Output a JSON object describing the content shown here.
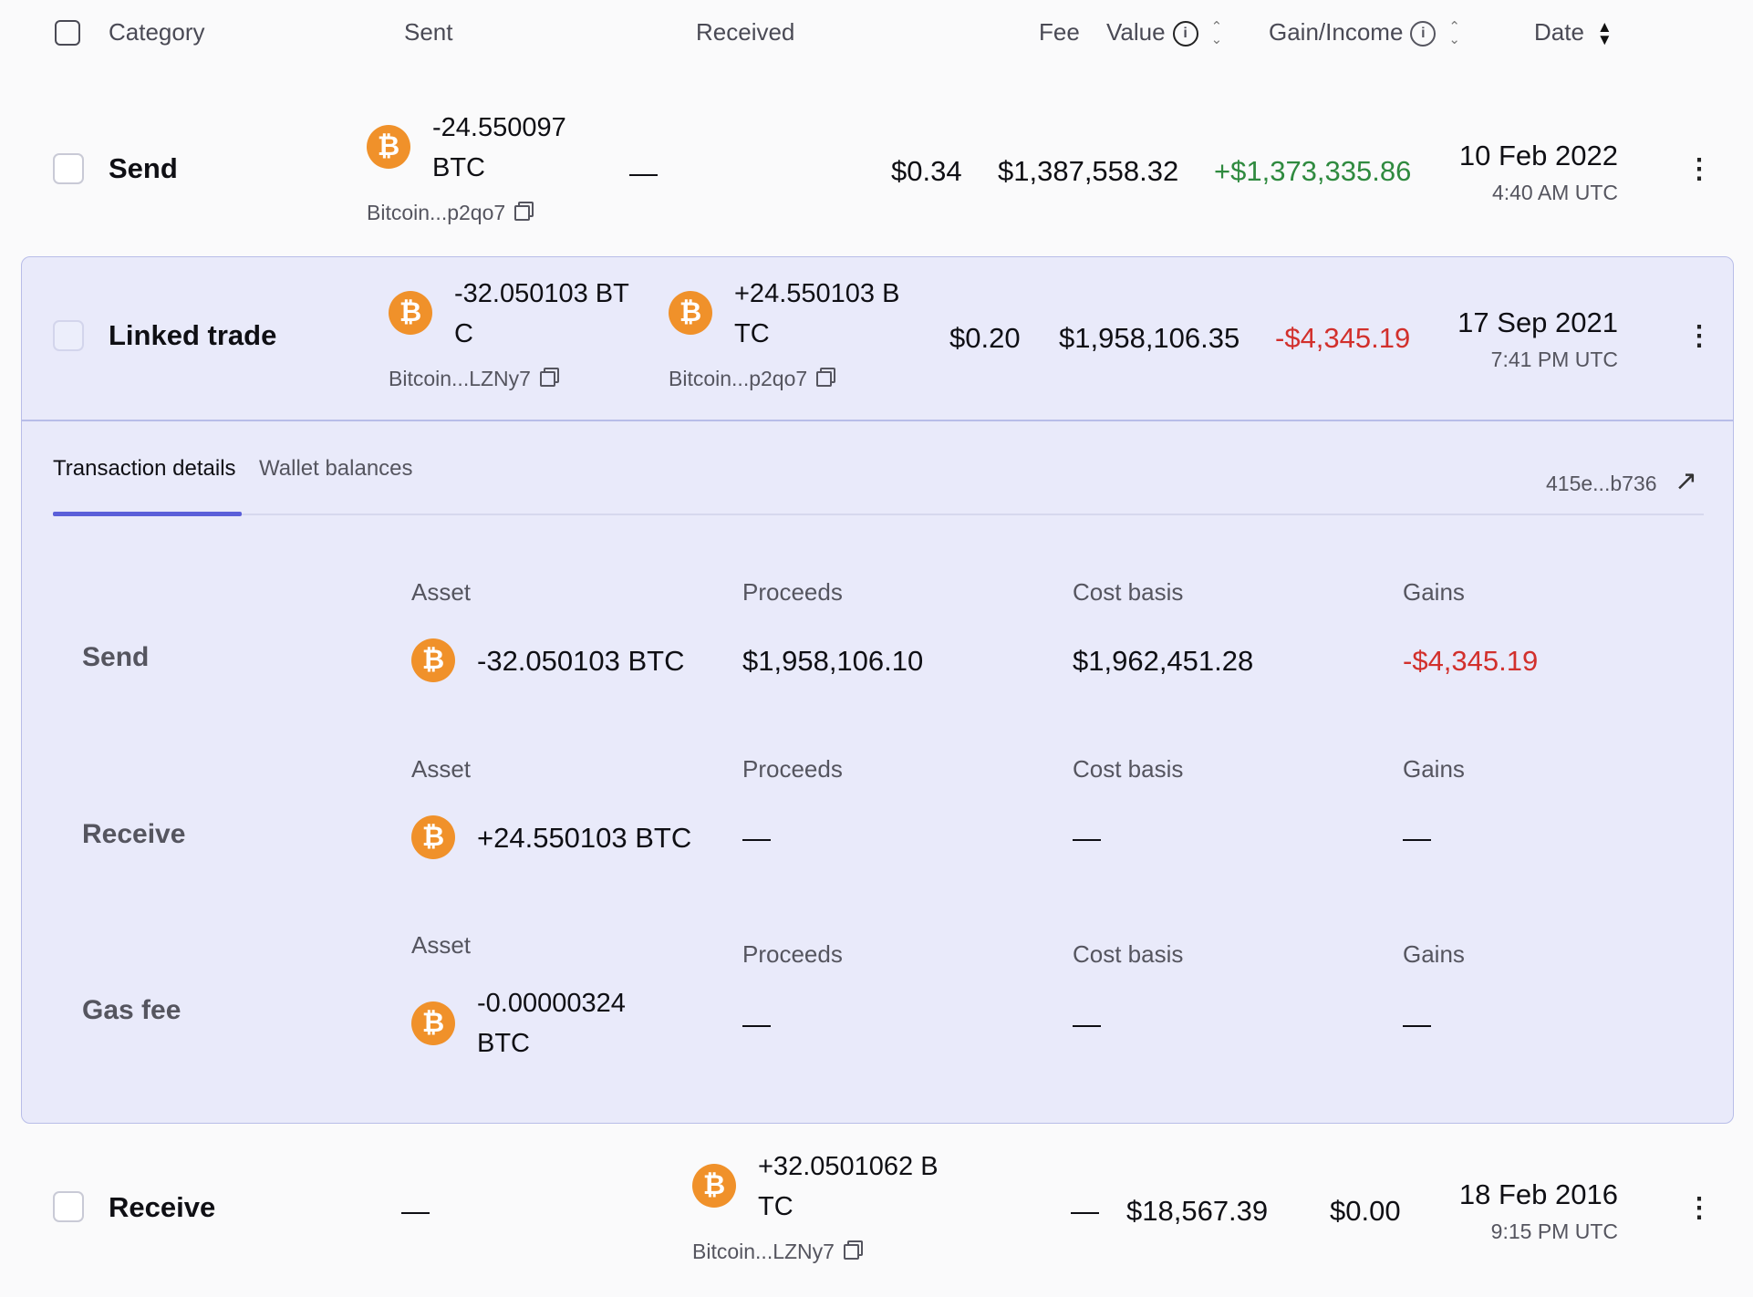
{
  "header": {
    "category": "Category",
    "sent": "Sent",
    "received": "Received",
    "fee": "Fee",
    "value": "Value",
    "gain_income": "Gain/Income",
    "date": "Date"
  },
  "rows": [
    {
      "category": "Send",
      "sent_amount_line1": "-24.550097",
      "sent_amount_line2": "BTC",
      "sent_wallet": "Bitcoin...p2qo7",
      "received": "—",
      "fee": "$0.34",
      "value": "$1,387,558.32",
      "gain": "+$1,373,335.86",
      "date": "10 Feb 2022",
      "time": "4:40 AM UTC"
    },
    {
      "category": "Linked trade",
      "sent_amount_line1": "-32.050103 BT",
      "sent_amount_line2": "C",
      "sent_wallet": "Bitcoin...LZNy7",
      "received_amount_line1": "+24.550103 B",
      "received_amount_line2": "TC",
      "received_wallet": "Bitcoin...p2qo7",
      "fee": "$0.20",
      "value": "$1,958,106.35",
      "gain": "-$4,345.19",
      "date": "17 Sep 2021",
      "time": "7:41 PM UTC"
    },
    {
      "category": "Receive",
      "sent": "—",
      "received_amount_line1": "+32.0501062 B",
      "received_amount_line2": "TC",
      "received_wallet": "Bitcoin...LZNy7",
      "fee": "—",
      "value": "$18,567.39",
      "gain": "$0.00",
      "date": "18 Feb 2016",
      "time": "9:15 PM UTC"
    }
  ],
  "details": {
    "tabs": [
      "Transaction details",
      "Wallet balances"
    ],
    "tx_hash": "415e...b736",
    "col_asset": "Asset",
    "col_proceeds": "Proceeds",
    "col_cost_basis": "Cost basis",
    "col_gains": "Gains",
    "items": [
      {
        "label": "Send",
        "asset": "-32.050103 BTC",
        "proceeds": "$1,958,106.10",
        "cost_basis": "$1,962,451.28",
        "gains": "-$4,345.19"
      },
      {
        "label": "Receive",
        "asset": "+24.550103 BTC",
        "proceeds": "—",
        "cost_basis": "—",
        "gains": "—"
      },
      {
        "label": "Gas fee",
        "asset_line1": "-0.00000324",
        "asset_line2": "BTC",
        "proceeds": "—",
        "cost_basis": "—",
        "gains": "—"
      }
    ]
  },
  "icons": {
    "bitcoin": "₿",
    "kebab": "⋮",
    "external_link": "↗",
    "info": "i"
  },
  "colors": {
    "accent": "#5b5fd9",
    "btc": "#f0912a",
    "gain": "#2f8a3f",
    "loss": "#d2302c",
    "panel_bg": "#e9eafa"
  }
}
